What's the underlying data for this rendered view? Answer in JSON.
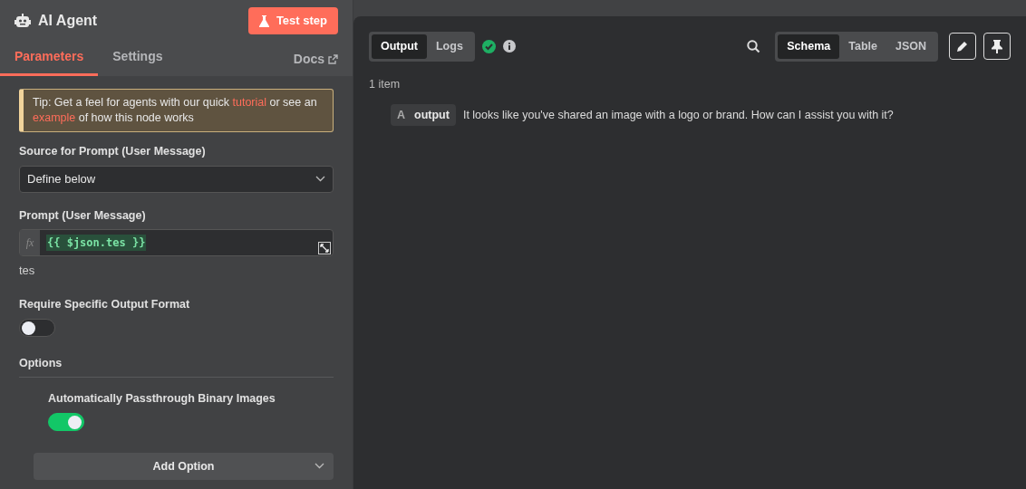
{
  "node": {
    "title": "AI Agent",
    "test_button": "Test step"
  },
  "tabs": [
    {
      "label": "Parameters",
      "selected": true
    },
    {
      "label": "Settings",
      "selected": false
    }
  ],
  "docs_link": "Docs",
  "tip": [
    {
      "text": "Tip: Get a feel for agents with our quick ",
      "kind": "text"
    },
    {
      "text": "tutorial",
      "kind": "link"
    },
    {
      "text": " or see an ",
      "kind": "text"
    },
    {
      "text": "example",
      "kind": "link"
    },
    {
      "text": " of how this node works",
      "kind": "text"
    }
  ],
  "source": {
    "label": "Source for Prompt (User Message)",
    "value": "Define below"
  },
  "prompt": {
    "label": "Prompt (User Message)",
    "mode_label": "fx",
    "expression": "{{ $json.tes }}",
    "preview": "tes"
  },
  "require_format": {
    "label": "Require Specific Output Format",
    "on": false
  },
  "options": {
    "heading": "Options",
    "items": [
      {
        "label": "Automatically Passthrough Binary Images",
        "on": true
      }
    ],
    "add_button": "Add Option"
  },
  "view_tabs": [
    {
      "label": "Output",
      "selected": true
    },
    {
      "label": "Logs",
      "selected": false
    }
  ],
  "run": {
    "success": true
  },
  "display_modes": [
    {
      "label": "Schema",
      "selected": true
    },
    {
      "label": "Table",
      "selected": false
    },
    {
      "label": "JSON",
      "selected": false
    }
  ],
  "item_count": "1 item",
  "schema": [
    {
      "type": "A",
      "key": "output",
      "value": "It looks like you've shared an image with a logo or brand. How can I assist you with it?"
    }
  ]
}
